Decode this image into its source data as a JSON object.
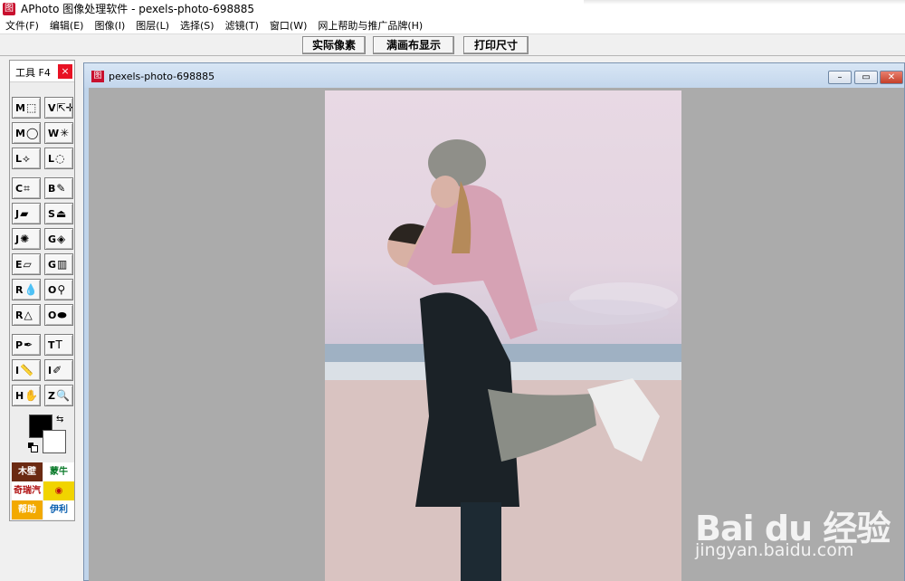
{
  "window": {
    "title": "APhoto 图像处理软件 - pexels-photo-698885",
    "app_icon": "图"
  },
  "menu": [
    "文件(F)",
    "编辑(E)",
    "图像(I)",
    "图层(L)",
    "选择(S)",
    "滤镜(T)",
    "窗口(W)",
    "网上帮助与推广品牌(H)"
  ],
  "toolbar": {
    "actual_pixels": "实际像素",
    "fit_canvas": "满画布显示",
    "print_size": "打印尺寸"
  },
  "palette": {
    "title": "工具 F4",
    "close": "×",
    "tools": [
      {
        "key": "M",
        "icon": "rect-select-icon",
        "glyph": "⬚"
      },
      {
        "key": "V",
        "icon": "move-icon",
        "glyph": "⇱✛"
      },
      {
        "key": "M",
        "icon": "ellipse-select-icon",
        "glyph": "◯"
      },
      {
        "key": "W",
        "icon": "magic-wand-icon",
        "glyph": "✳"
      },
      {
        "key": "L",
        "icon": "polygon-lasso-icon",
        "glyph": "⟡"
      },
      {
        "key": "L",
        "icon": "lasso-icon",
        "glyph": "◌"
      },
      {
        "key": "C",
        "icon": "crop-icon",
        "glyph": "⌗"
      },
      {
        "key": "B",
        "icon": "brush-icon",
        "glyph": "✎"
      },
      {
        "key": "J",
        "icon": "healing-icon",
        "glyph": "▰"
      },
      {
        "key": "S",
        "icon": "stamp-icon",
        "glyph": "⏏"
      },
      {
        "key": "J",
        "icon": "patch-icon",
        "glyph": "✺"
      },
      {
        "key": "G",
        "icon": "bucket-icon",
        "glyph": "◈"
      },
      {
        "key": "E",
        "icon": "eraser-icon",
        "glyph": "▱"
      },
      {
        "key": "G",
        "icon": "gradient-icon",
        "glyph": "▥"
      },
      {
        "key": "R",
        "icon": "blur-icon",
        "glyph": "💧"
      },
      {
        "key": "O",
        "icon": "dodge-icon",
        "glyph": "⚲"
      },
      {
        "key": "R",
        "icon": "sharpen-icon",
        "glyph": "△"
      },
      {
        "key": "O",
        "icon": "sponge-icon",
        "glyph": "⬬"
      },
      {
        "key": "P",
        "icon": "pen-icon",
        "glyph": "✒"
      },
      {
        "key": "T",
        "icon": "text-icon",
        "glyph": "T"
      },
      {
        "key": "I",
        "icon": "measure-icon",
        "glyph": "📏"
      },
      {
        "key": "I",
        "icon": "eyedropper-icon",
        "glyph": "✐"
      },
      {
        "key": "H",
        "icon": "hand-icon",
        "glyph": "✋"
      },
      {
        "key": "Z",
        "icon": "zoom-icon",
        "glyph": "🔍"
      }
    ],
    "swap": "⇆",
    "ads": [
      {
        "label": "木壁",
        "bg": "#6b2a12",
        "fg": "#ffffff"
      },
      {
        "label": "蒙牛",
        "bg": "#ffffff",
        "fg": "#0a7a2a"
      },
      {
        "label": "奇瑞汽车",
        "bg": "#ffffff",
        "fg": "#b01010"
      },
      {
        "label": "◉",
        "bg": "#f1d400",
        "fg": "#c01010"
      },
      {
        "label": "帮助",
        "bg": "#f2a900",
        "fg": "#ffffff"
      },
      {
        "label": "伊利",
        "bg": "#ffffff",
        "fg": "#0a5fb0"
      }
    ]
  },
  "document": {
    "title": "pexels-photo-698885",
    "icon": "图",
    "minimize": "–",
    "maximize": "▭",
    "close": "✕"
  },
  "watermark": {
    "brand": "Bai du 经验",
    "sub": "jingyan.baidu.com"
  },
  "colors": {
    "accent_red": "#c8102e",
    "doc_frame": "#c0d4ea",
    "canvas_bg": "#ababab"
  }
}
